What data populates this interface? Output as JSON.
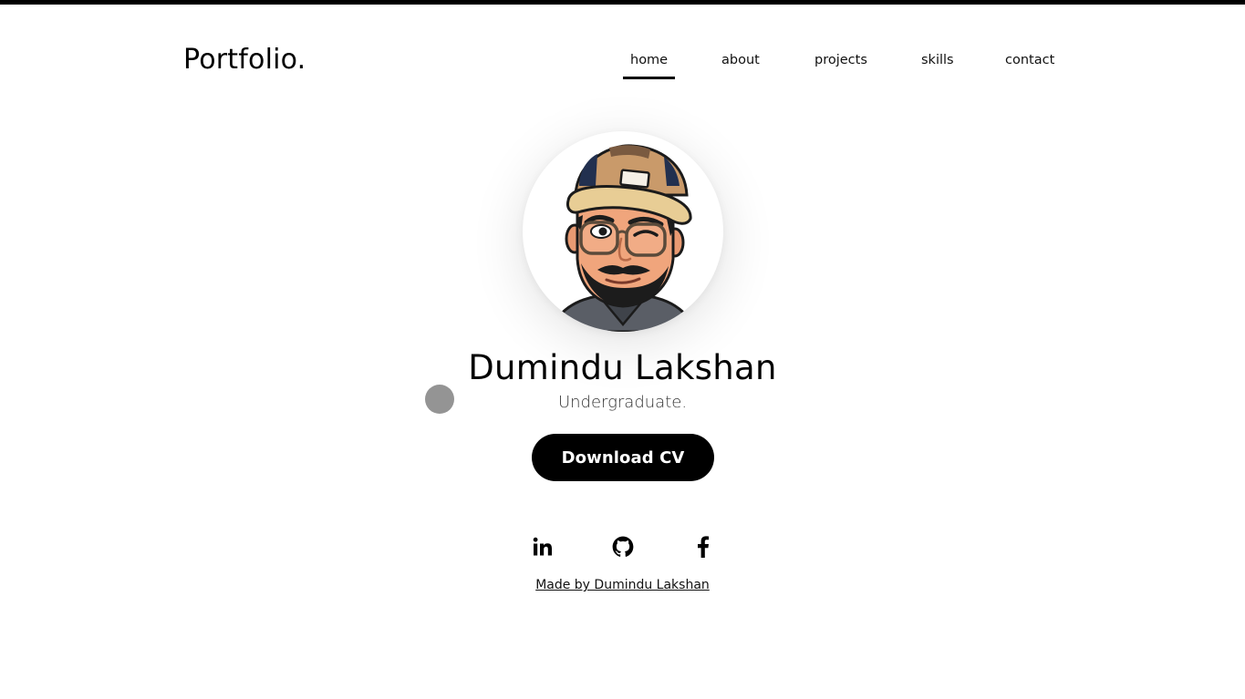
{
  "brand": {
    "logo_text": "Portfolio."
  },
  "nav": {
    "items": [
      {
        "label": "home",
        "active": true
      },
      {
        "label": "about",
        "active": false
      },
      {
        "label": "projects",
        "active": false
      },
      {
        "label": "skills",
        "active": false
      },
      {
        "label": "contact",
        "active": false
      }
    ]
  },
  "hero": {
    "avatar_icon": "cartoon-avatar-cap-glasses",
    "name": "Dumindu Lakshan",
    "subtitle": "Undergraduate.",
    "cv_button_label": "Download CV"
  },
  "social": {
    "links": [
      {
        "icon": "linkedin-icon"
      },
      {
        "icon": "github-icon"
      },
      {
        "icon": "facebook-icon"
      }
    ]
  },
  "footer": {
    "credit_text": "Made by Dumindu Lakshan"
  },
  "colors": {
    "accent": "#000000",
    "background": "#ffffff",
    "cursor": "#8e8e8e"
  }
}
